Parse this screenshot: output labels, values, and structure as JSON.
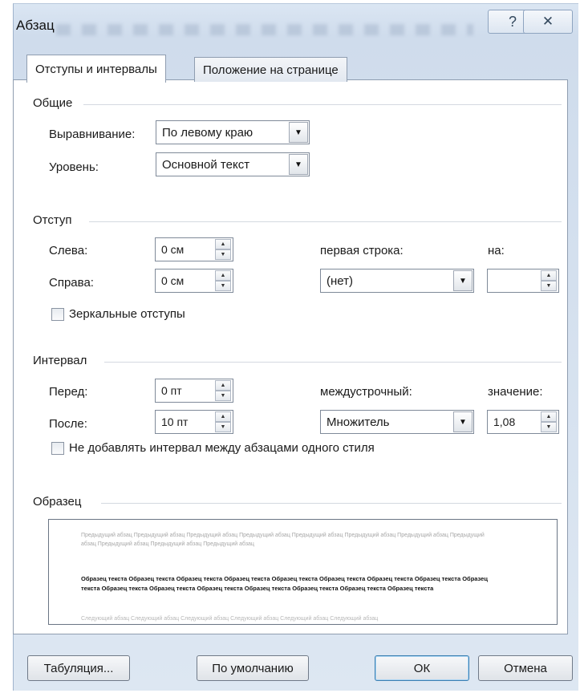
{
  "window": {
    "title": "Абзац",
    "help_icon": "help-icon",
    "close_icon": "close-icon"
  },
  "tabs": [
    {
      "label": "Отступы и интервалы",
      "active": true
    },
    {
      "label": "Положение на странице",
      "active": false
    }
  ],
  "general": {
    "heading": "Общие",
    "alignment_label": "Выравнивание:",
    "alignment_value": "По левому краю",
    "level_label": "Уровень:",
    "level_value": "Основной текст"
  },
  "indent": {
    "heading": "Отступ",
    "left_label": "Слева:",
    "left_value": "0 см",
    "right_label": "Справа:",
    "right_value": "0 см",
    "first_line_label": "первая строка:",
    "first_line_value": "(нет)",
    "by_label": "на:",
    "by_value": "",
    "mirror_label": "Зеркальные отступы",
    "mirror_checked": false
  },
  "spacing": {
    "heading": "Интервал",
    "before_label": "Перед:",
    "before_value": "0 пт",
    "after_label": "После:",
    "after_value": "10 пт",
    "line_label": "междустрочный:",
    "line_value": "Множитель",
    "at_label": "значение:",
    "at_value": "1,08",
    "dont_add_label": "Не добавлять интервал между абзацами одного стиля",
    "dont_add_checked": false
  },
  "preview": {
    "heading": "Образец",
    "prev_text": "Предыдущий абзац Предыдущий абзац Предыдущий абзац Предыдущий абзац Предыдущий абзац Предыдущий абзац Предыдущий абзац Предыдущий абзац Предыдущий абзац Предыдущий абзац Предыдущий абзац",
    "sample_text": "Образец текста Образец текста Образец текста Образец текста Образец текста Образец текста Образец текста Образец текста Образец текста Образец текста Образец текста Образец текста Образец текста Образец текста Образец текста Образец текста",
    "next_text": "Следующий абзац Следующий абзац Следующий абзац Следующий абзац Следующий абзац Следующий абзац"
  },
  "buttons": {
    "tabs_label": "Табуляция...",
    "default_label": "По умолчанию",
    "ok_label": "ОК",
    "cancel_label": "Отмена"
  },
  "colors": {
    "title_bar": "#cfdcec",
    "panel": "#ffffff",
    "default_button_border": "#3c7fb1"
  }
}
